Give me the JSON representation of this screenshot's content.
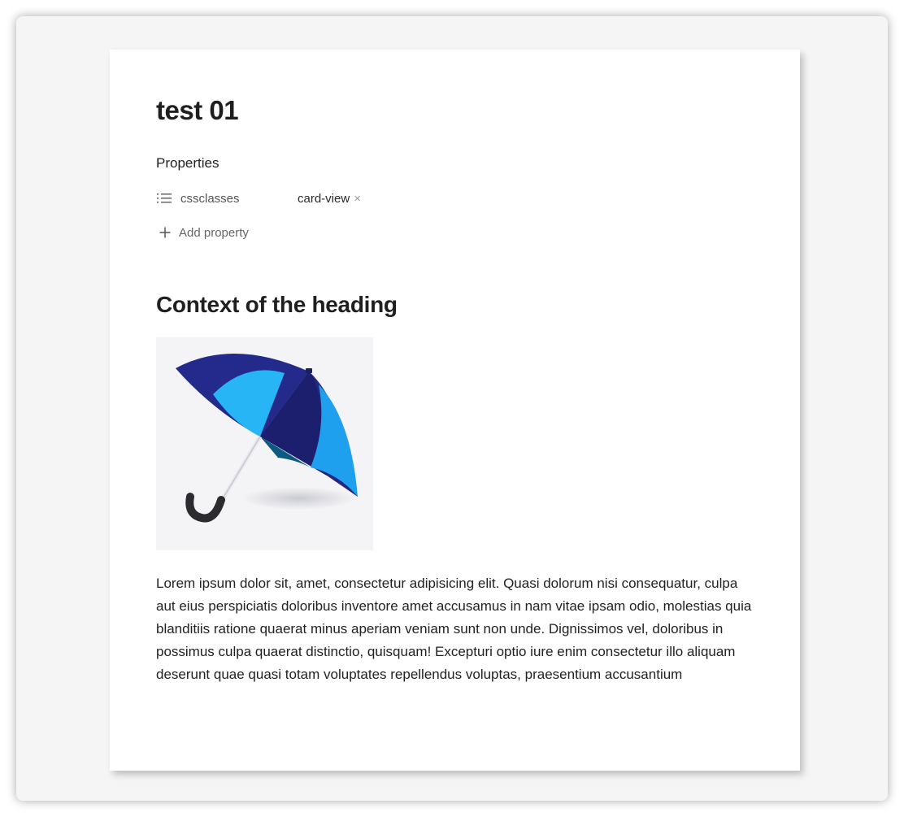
{
  "note": {
    "title": "test 01"
  },
  "properties": {
    "heading": "Properties",
    "items": [
      {
        "icon": "list-icon",
        "key": "cssclasses",
        "tags": [
          "card-view"
        ]
      }
    ],
    "remove_glyph": "×",
    "add_label": "Add property"
  },
  "content": {
    "heading": "Context of the heading",
    "paragraph": "Lorem ipsum dolor sit, amet, consectetur adipisicing elit. Quasi dolorum nisi consequatur, culpa aut eius perspiciatis doloribus inventore amet accusamus in nam vitae ipsam odio, molestias quia blanditiis ratione quaerat minus aperiam veniam sunt non unde. Dignissimos vel, doloribus in possimus culpa quaerat distinctio, quisquam! Excepturi optio iure enim consectetur illo aliquam deserunt quae quasi totam voluptates repellendus voluptas, praesentium accusantium"
  },
  "colors": {
    "background": "#f5f5f5",
    "card": "#ffffff",
    "umbrella_dark": "#232a8c",
    "umbrella_light": "#1ea8f0"
  }
}
